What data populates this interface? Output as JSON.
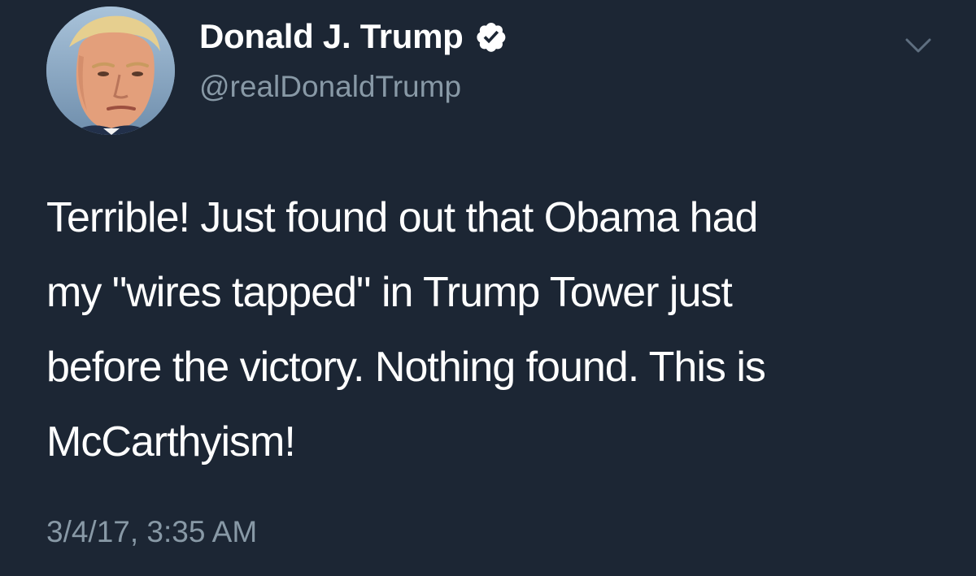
{
  "tweet": {
    "author": {
      "display_name": "Donald J. Trump",
      "handle": "@realDonaldTrump",
      "verified": true
    },
    "text": "Terrible! Just found out that Obama had\nmy \"wires tapped\" in Trump Tower just\nbefore the victory. Nothing found. This is\nMcCarthyism!",
    "timestamp": "3/4/17, 3:35 AM"
  },
  "icons": {
    "verified": "verified-badge-icon",
    "menu": "chevron-down-icon"
  },
  "colors": {
    "background": "#1c2634",
    "text_primary": "#ffffff",
    "text_secondary": "#8899a6"
  }
}
